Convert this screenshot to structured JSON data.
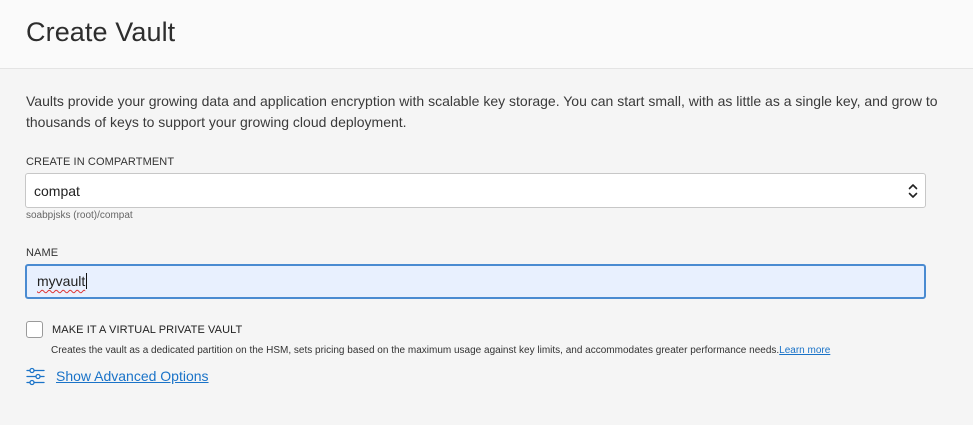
{
  "header": {
    "title": "Create Vault"
  },
  "description": "Vaults provide your growing data and application encryption with scalable key storage. You can start small, with as little as a single key, and grow to thousands of keys to support your growing cloud deployment.",
  "compartment": {
    "label": "CREATE IN COMPARTMENT",
    "selected": "compat",
    "path_hint": "soabpjsks (root)/compat"
  },
  "name_field": {
    "label": "NAME",
    "value": "myvault"
  },
  "virtual_private_vault": {
    "label": "MAKE IT A VIRTUAL PRIVATE VAULT",
    "checked": false,
    "description": "Creates the vault as a dedicated partition on the HSM, sets pricing based on the maximum usage against key limits, and accommodates greater performance needs.",
    "learn_more": "Learn more"
  },
  "advanced": {
    "link_label": "Show Advanced Options",
    "icon": "sliders-icon"
  },
  "colors": {
    "link": "#1a73c8",
    "focus_border": "#4a8bd1",
    "focus_bg": "#e8f0fe"
  }
}
